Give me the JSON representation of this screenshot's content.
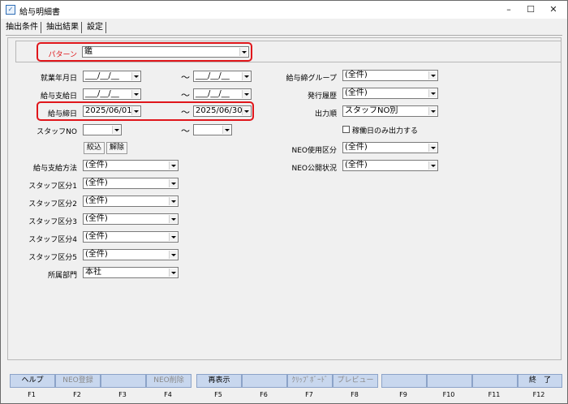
{
  "window": {
    "title": "給与明細書",
    "minimize": "–",
    "maximize": "☐",
    "close": "✕",
    "icon": "app-icon"
  },
  "tabs": [
    "抽出条件",
    "抽出結果",
    "設定"
  ],
  "pattern": {
    "label": "パターン",
    "value": "鑑"
  },
  "left": {
    "shugyo": {
      "label": "就業年月日",
      "from": "___/__/__",
      "to": "___/__/__"
    },
    "kyuyo_shikyu": {
      "label": "給与支給日",
      "from": "___/__/__",
      "to": "___/__/__"
    },
    "kyuyo_shime": {
      "label": "給与締日",
      "from": "2025/06/01",
      "to": "2025/06/30"
    },
    "staff_no": {
      "label": "スタッフNO",
      "from": "",
      "to": ""
    },
    "tilde": "～",
    "narrow_button": "絞込",
    "clear_button": "解除",
    "shikyu_hoho": {
      "label": "給与支給方法",
      "value": "(全件)"
    },
    "kubun1": {
      "label": "スタッフ区分1",
      "value": "(全件)"
    },
    "kubun2": {
      "label": "スタッフ区分2",
      "value": "(全件)"
    },
    "kubun3": {
      "label": "スタッフ区分3",
      "value": "(全件)"
    },
    "kubun4": {
      "label": "スタッフ区分4",
      "value": "(全件)"
    },
    "kubun5": {
      "label": "スタッフ区分5",
      "value": "(全件)"
    },
    "busho": {
      "label": "所属部門",
      "value": "本社"
    }
  },
  "right": {
    "shime_group": {
      "label": "給与締グループ",
      "value": "(全件)"
    },
    "hakko_rireki": {
      "label": "発行履歴",
      "value": "(全件)"
    },
    "shutsuryoku_jun": {
      "label": "出力順",
      "value": "スタッフNO別"
    },
    "kado_only": {
      "label": "稼働日のみ出力する",
      "checked": false
    },
    "neo_shiyo": {
      "label": "NEO使用区分",
      "value": "(全件)"
    },
    "neo_kokai": {
      "label": "NEO公開状況",
      "value": "(全件)"
    }
  },
  "fkeys": [
    {
      "label": "ヘルプ",
      "key": "F1",
      "enabled": true
    },
    {
      "label": "NEO登録",
      "key": "F2",
      "enabled": false
    },
    {
      "label": "",
      "key": "F3",
      "enabled": false
    },
    {
      "label": "NEO削除",
      "key": "F4",
      "enabled": false
    },
    {
      "label": "再表示",
      "key": "F5",
      "enabled": true
    },
    {
      "label": "",
      "key": "F6",
      "enabled": false
    },
    {
      "label": "ｸﾘｯﾌﾟﾎﾞｰﾄﾞ",
      "key": "F7",
      "enabled": false
    },
    {
      "label": "プレビュー",
      "key": "F8",
      "enabled": false
    },
    {
      "label": "",
      "key": "F9",
      "enabled": false
    },
    {
      "label": "",
      "key": "F10",
      "enabled": false
    },
    {
      "label": "",
      "key": "F11",
      "enabled": false
    },
    {
      "label": "終　了",
      "key": "F12",
      "enabled": true
    }
  ],
  "highlight_color": "#e0161b"
}
